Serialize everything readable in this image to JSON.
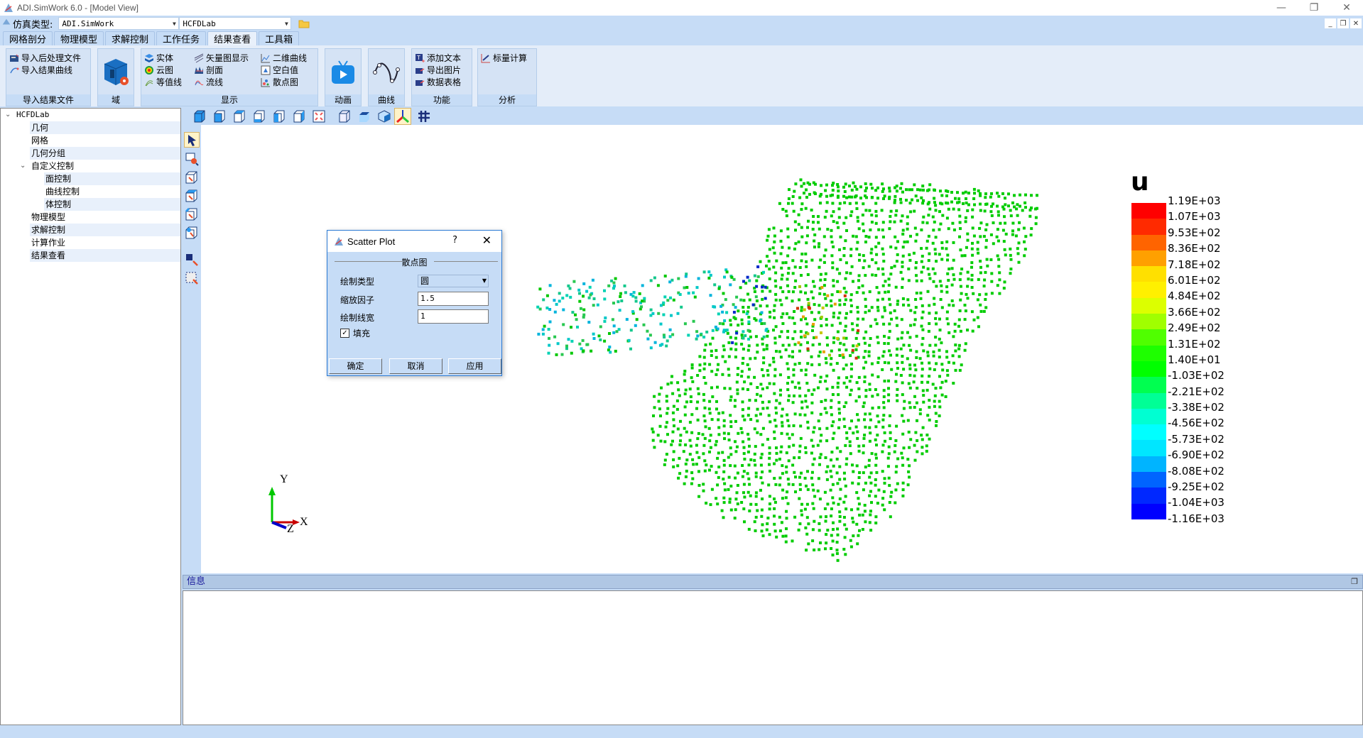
{
  "window": {
    "title": "ADI.SimWork 6.0 - [Model View]",
    "controls": {
      "minimize": "—",
      "restore": "❐",
      "close": "✕"
    },
    "mdi_controls": {
      "minimize": "_",
      "restore": "❐",
      "close": "✕"
    }
  },
  "simtype": {
    "label": "仿真类型:",
    "combo1_value": "ADI.SimWork",
    "combo2_value": "HCFDLab"
  },
  "tabs": [
    {
      "label": "网格剖分",
      "active": false
    },
    {
      "label": "物理模型",
      "active": false
    },
    {
      "label": "求解控制",
      "active": false
    },
    {
      "label": "工作任务",
      "active": false
    },
    {
      "label": "结果查看",
      "active": true
    },
    {
      "label": "工具箱",
      "active": false
    }
  ],
  "ribbon": {
    "import_group": {
      "title": "导入结果文件",
      "items": [
        "导入后处理文件",
        "导入结果曲线"
      ]
    },
    "domain_group": {
      "title": "域"
    },
    "display_group": {
      "title": "显示",
      "items": [
        "实体",
        "云图",
        "等值线",
        "矢量图显示",
        "剖面",
        "流线",
        "二维曲线",
        "空白值",
        "散点图"
      ]
    },
    "animation_group": {
      "title": "动画"
    },
    "curve_group": {
      "title": "曲线"
    },
    "function_group": {
      "title": "功能",
      "items": [
        "添加文本",
        "导出图片",
        "数据表格"
      ]
    },
    "analysis_group": {
      "title": "分析",
      "items": [
        "标量计算"
      ]
    }
  },
  "tree": {
    "root": "HCFDLab",
    "items": [
      {
        "label": "几何",
        "level": 1
      },
      {
        "label": "网格",
        "level": 1
      },
      {
        "label": "几何分组",
        "level": 1
      },
      {
        "label": "自定义控制",
        "level": 1,
        "expanded": true
      },
      {
        "label": "面控制",
        "level": 2
      },
      {
        "label": "曲线控制",
        "level": 2
      },
      {
        "label": "体控制",
        "level": 2
      },
      {
        "label": "物理模型",
        "level": 1
      },
      {
        "label": "求解控制",
        "level": 1
      },
      {
        "label": "计算作业",
        "level": 1
      },
      {
        "label": "结果查看",
        "level": 1
      }
    ]
  },
  "legend": {
    "variable": "u",
    "labels": [
      "1.19E+03",
      "1.07E+03",
      "9.53E+02",
      "8.36E+02",
      "7.18E+02",
      "6.01E+02",
      "4.84E+02",
      "3.66E+02",
      "2.49E+02",
      "1.31E+02",
      "1.40E+01",
      "-1.03E+02",
      "-2.21E+02",
      "-3.38E+02",
      "-4.56E+02",
      "-5.73E+02",
      "-6.90E+02",
      "-8.08E+02",
      "-9.25E+02",
      "-1.04E+03",
      "-1.16E+03"
    ],
    "colors": [
      "#ff0000",
      "#ff2a00",
      "#ff6400",
      "#ffa000",
      "#ffe000",
      "#fff000",
      "#dcff00",
      "#a0ff00",
      "#50ff00",
      "#1eff00",
      "#00ff00",
      "#00ff50",
      "#00ff96",
      "#00ffd2",
      "#00ffff",
      "#00e6ff",
      "#00b4ff",
      "#0064ff",
      "#0028ff",
      "#0000ff"
    ]
  },
  "axes_triad": {
    "x": "X",
    "y": "Y",
    "z": "Z"
  },
  "info_panel": {
    "title": "信息",
    "restore_icon": "❐"
  },
  "dialog": {
    "title": "Scatter Plot",
    "help": "?",
    "close": "✕",
    "group_title": "散点图",
    "plot_type_label": "绘制类型",
    "plot_type_value": "圆",
    "scale_label": "缩放因子",
    "scale_value": "1.5",
    "linewidth_label": "绘制线宽",
    "linewidth_value": "1",
    "fill_label": "填充",
    "fill_checked": true,
    "ok": "确定",
    "cancel": "取消",
    "apply": "应用"
  },
  "colors": {
    "accent": "#c6dcf6",
    "scatter_main": "#00cc00",
    "scatter_cyan": "#00c8c8"
  }
}
